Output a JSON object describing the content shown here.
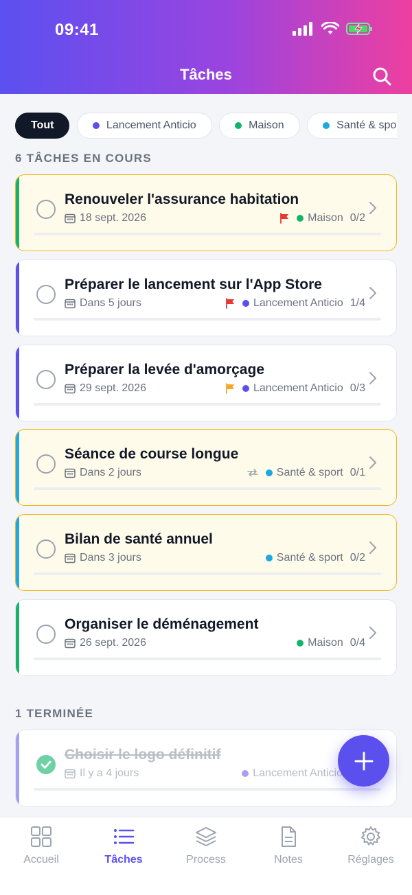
{
  "status_bar": {
    "time": "09:41"
  },
  "header": {
    "title": "Tâches"
  },
  "filters": [
    {
      "label": "Tout",
      "active": true,
      "color": ""
    },
    {
      "label": "Lancement Anticio",
      "active": false,
      "color": "#5b50ee"
    },
    {
      "label": "Maison",
      "active": false,
      "color": "#17b26a"
    },
    {
      "label": "Santé & sport",
      "active": false,
      "color": "#1ea7e1"
    }
  ],
  "sections": {
    "in_progress": "6 TÂCHES EN COURS",
    "done": "1 TERMINÉE"
  },
  "tasks": [
    {
      "title": "Renouveler l'assurance habitation",
      "date": "18 sept. 2026",
      "flag": "red",
      "category": "Maison",
      "count": "0/2",
      "progress": 0,
      "highlight": true,
      "accent": "#17b26a",
      "dot": "#17b26a"
    },
    {
      "title": "Préparer le lancement sur l'App Store",
      "date": "Dans 5 jours",
      "flag": "red",
      "category": "Lancement Anticio",
      "count": "1/4",
      "progress": 0.25,
      "highlight": false,
      "accent": "#5b50ee",
      "dot": "#5b50ee"
    },
    {
      "title": "Préparer la levée d'amorçage",
      "date": "29 sept. 2026",
      "flag": "orange",
      "category": "Lancement Anticio",
      "count": "0/3",
      "progress": 0,
      "highlight": false,
      "accent": "#5b50ee",
      "dot": "#5b50ee"
    },
    {
      "title": "Séance de course longue",
      "date": "Dans 2 jours",
      "flag": "repeat",
      "category": "Santé & sport",
      "count": "0/1",
      "progress": 0,
      "highlight": true,
      "accent": "#1ea7e1",
      "dot": "#1ea7e1"
    },
    {
      "title": "Bilan de santé annuel",
      "date": "Dans 3 jours",
      "flag": "",
      "category": "Santé & sport",
      "count": "0/2",
      "progress": 0,
      "highlight": true,
      "accent": "#1ea7e1",
      "dot": "#1ea7e1"
    },
    {
      "title": "Organiser le déménagement",
      "date": "26 sept. 2026",
      "flag": "",
      "category": "Maison",
      "count": "0/4",
      "progress": 0,
      "highlight": false,
      "accent": "#17b26a",
      "dot": "#17b26a"
    }
  ],
  "done_tasks": [
    {
      "title": "Choisir le logo définitif",
      "date": "Il y a 4 jours",
      "category": "Lancement Anticio",
      "progress": 1,
      "accent": "#a99ff0",
      "dot": "#a99ff0"
    }
  ],
  "fab": {
    "icon": "plus-icon"
  },
  "tabbar": [
    {
      "label": "Accueil",
      "icon": "grid-icon",
      "active": false
    },
    {
      "label": "Tâches",
      "icon": "list-icon",
      "active": true
    },
    {
      "label": "Process",
      "icon": "layers-icon",
      "active": false
    },
    {
      "label": "Notes",
      "icon": "document-icon",
      "active": false
    },
    {
      "label": "Réglages",
      "icon": "gear-icon",
      "active": false
    }
  ],
  "colors": {
    "accent": "#5b50ee",
    "highlight_border": "#f2b619",
    "flag_red": "#e53935",
    "flag_orange": "#f5a623"
  }
}
